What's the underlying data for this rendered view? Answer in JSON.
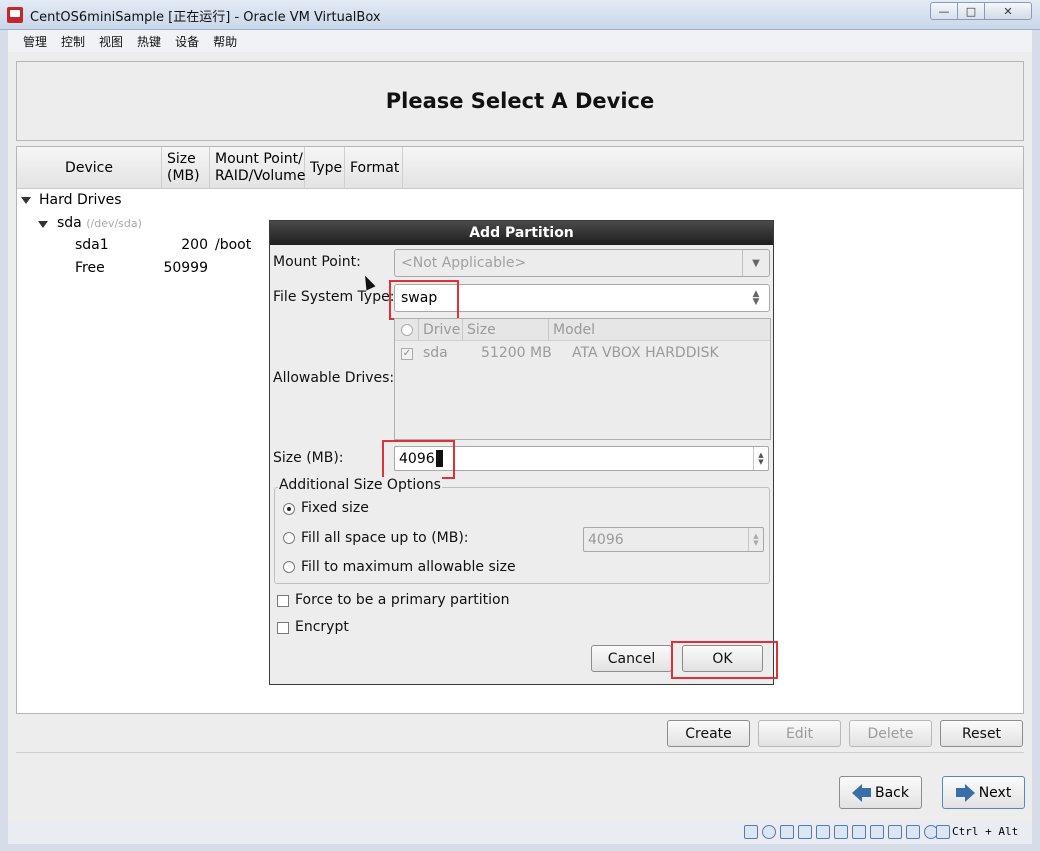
{
  "window": {
    "title": "CentOS6miniSample [正在运行] - Oracle VM VirtualBox",
    "min_glyph": "—",
    "max_glyph": "□",
    "close_glyph": "✕"
  },
  "menu": [
    "管理",
    "控制",
    "视图",
    "热键",
    "设备",
    "帮助"
  ],
  "installer": {
    "title": "Please Select A Device",
    "columns": [
      "Device",
      "Size\n(MB)",
      "Mount Point/\nRAID/Volume",
      "Type",
      "Format"
    ],
    "tree": {
      "group": "Hard Drives",
      "disk": {
        "name": "sda",
        "path": "(/dev/sda)"
      },
      "rows": [
        {
          "name": "sda1",
          "size": "200",
          "mount": "/boot"
        },
        {
          "name": "Free",
          "size": "50999",
          "mount": ""
        }
      ]
    },
    "buttons": {
      "create": "Create",
      "edit": "Edit",
      "delete": "Delete",
      "reset": "Reset"
    },
    "nav": {
      "back": "Back",
      "next": "Next"
    }
  },
  "dialog": {
    "title": "Add Partition",
    "mount_point_label": "Mount Point:",
    "mount_point_value": "<Not Applicable>",
    "fs_type_label": "File System Type:",
    "fs_type_value": "swap",
    "allowable_label": "Allowable Drives:",
    "drive_columns": [
      "Drive",
      "Size",
      "Model"
    ],
    "drives": [
      {
        "drive": "sda",
        "size": "51200 MB",
        "model": "ATA VBOX HARDDISK",
        "checked": true
      }
    ],
    "size_label": "Size (MB):",
    "size_value": "4096",
    "size_options_label": "Additional Size Options",
    "options": {
      "fixed": "Fixed size",
      "fill_up_to": "Fill all space up to (MB):",
      "fill_up_to_value": "4096",
      "fill_max": "Fill to maximum allowable size"
    },
    "force_primary": "Force to be a primary partition",
    "encrypt": "Encrypt",
    "cancel": "Cancel",
    "ok": "OK"
  },
  "statusbar": {
    "hostkey": "Ctrl + Alt"
  },
  "colors": {
    "highlight": "#e0303a",
    "dialog_title": "#2a2a2a"
  }
}
